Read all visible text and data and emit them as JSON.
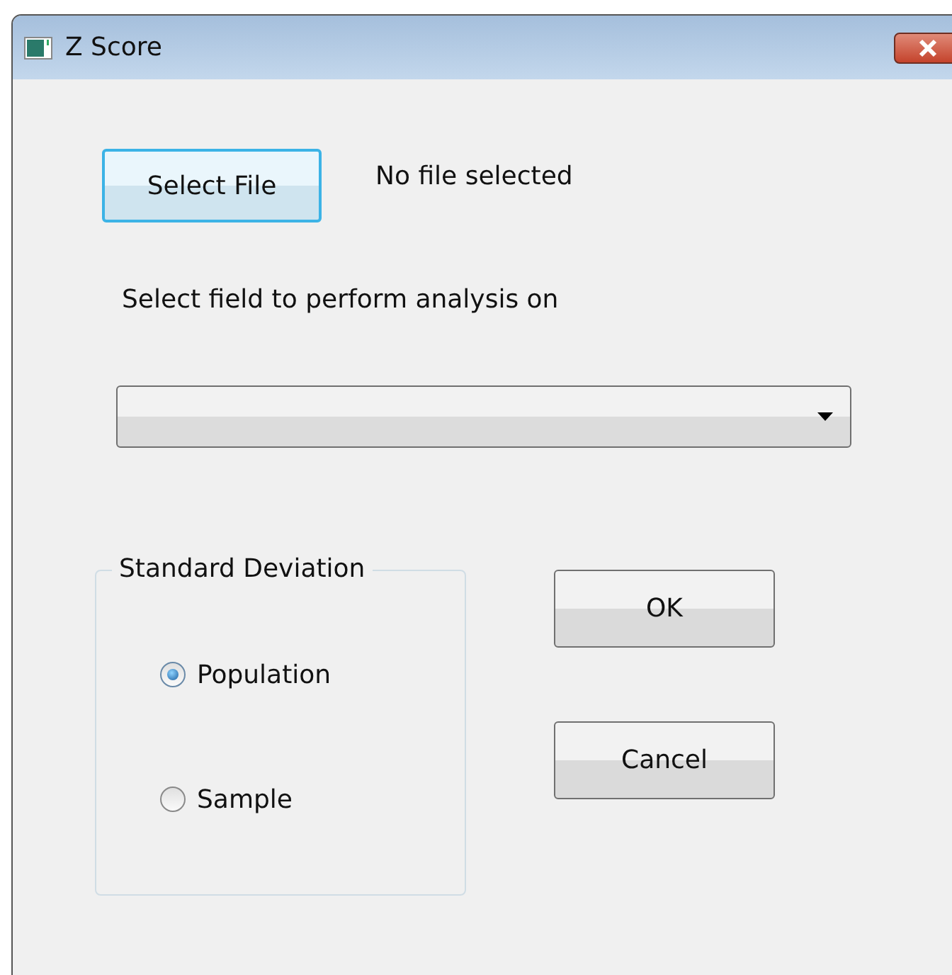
{
  "window": {
    "title": "Z Score"
  },
  "file": {
    "button": "Select File",
    "status": "No file selected"
  },
  "field": {
    "label": "Select field to perform analysis on"
  },
  "group": {
    "legend": "Standard Deviation",
    "options": [
      {
        "label": "Population",
        "selected": true
      },
      {
        "label": "Sample",
        "selected": false
      }
    ]
  },
  "buttons": [
    "OK",
    "Cancel"
  ]
}
